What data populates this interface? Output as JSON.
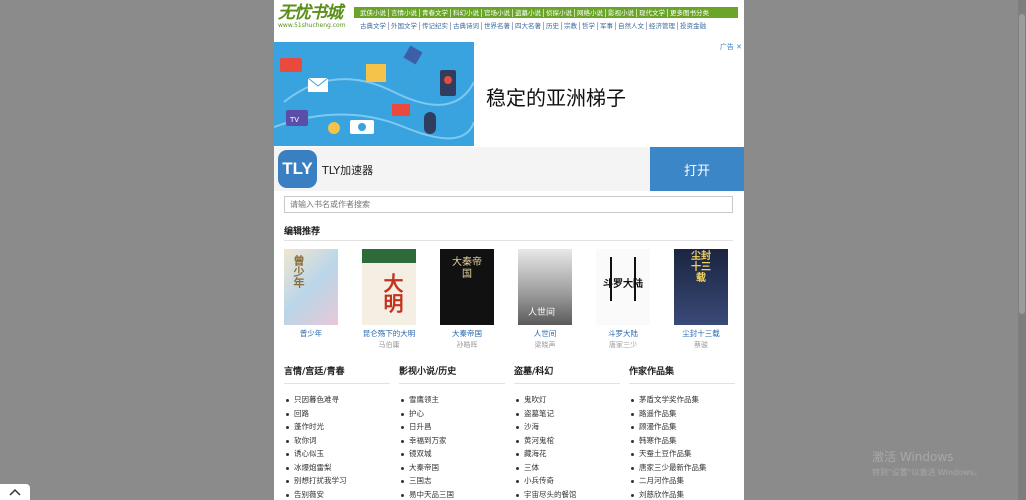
{
  "logo": {
    "title": "无忧书城",
    "url": "www.51shucheng.com"
  },
  "nav_primary": [
    "武侠小说",
    "言情小说",
    "青春文学",
    "科幻小说",
    "官场小说",
    "盗墓小说",
    "侦探小说",
    "网络小说",
    "影视小说",
    "现代文学",
    "更多图书分类"
  ],
  "nav_secondary": [
    "古典文学",
    "外国文学",
    "传记纪实",
    "古典诗词",
    "世界名著",
    "四大名著",
    "历史",
    "宗教",
    "哲学",
    "军事",
    "自然人文",
    "经济管理",
    "投资金融"
  ],
  "ad1": {
    "badge": "广告",
    "headline": "稳定的亚洲梯子"
  },
  "ad2": {
    "logo": "TLY",
    "name": "TLY加速器",
    "cta": "打开"
  },
  "search": {
    "placeholder": "请输入书名或作者搜索"
  },
  "recommend": {
    "title": "编辑推荐",
    "books": [
      {
        "title": "曾少年",
        "author": "",
        "cover": "曾少年"
      },
      {
        "title": "昆仑殇下的大明",
        "author": "马伯庸",
        "cover": "大明"
      },
      {
        "title": "大秦帝国",
        "author": "孙皓晖",
        "cover": "大秦帝国"
      },
      {
        "title": "人世间",
        "author": "梁晓声",
        "cover": "人世间"
      },
      {
        "title": "斗罗大陆",
        "author": "唐家三少",
        "cover": "斗罗大陆"
      },
      {
        "title": "尘封十三载",
        "author": "蔡骏",
        "cover": "尘封十三载"
      }
    ]
  },
  "columns": [
    {
      "title": "言情/宫廷/青春",
      "items": [
        "只因暮色难寻",
        "回路",
        "蓬作时光",
        "软你词",
        "诱心似玉",
        "冰爆炮雷梨",
        "别想打扰我学习",
        "告别薇安"
      ]
    },
    {
      "title": "影视小说/历史",
      "items": [
        "雪鹰领主",
        "护心",
        "日升昌",
        "幸福到万家",
        "镜双城",
        "大秦帝国",
        "三国志",
        "易中天品三国"
      ]
    },
    {
      "title": "盗墓/科幻",
      "items": [
        "鬼吹灯",
        "盗墓笔记",
        "沙海",
        "黄河鬼棺",
        "藏海花",
        "三体",
        "小兵传奇",
        "宇宙尽头的餐馆"
      ]
    },
    {
      "title": "作家作品集",
      "items": [
        "茅盾文学奖作品集",
        "路遥作品集",
        "顾漫作品集",
        "韩寒作品集",
        "天蚕土豆作品集",
        "唐家三少最新作品集",
        "二月河作品集",
        "刘慈欣作品集"
      ]
    }
  ],
  "watermark": {
    "line1": "激活 Windows",
    "line2": "转到\"设置\"以激活 Windows。"
  },
  "icons": {
    "scroll_top": "chevron-up-icon",
    "ad_close": "close-icon"
  }
}
